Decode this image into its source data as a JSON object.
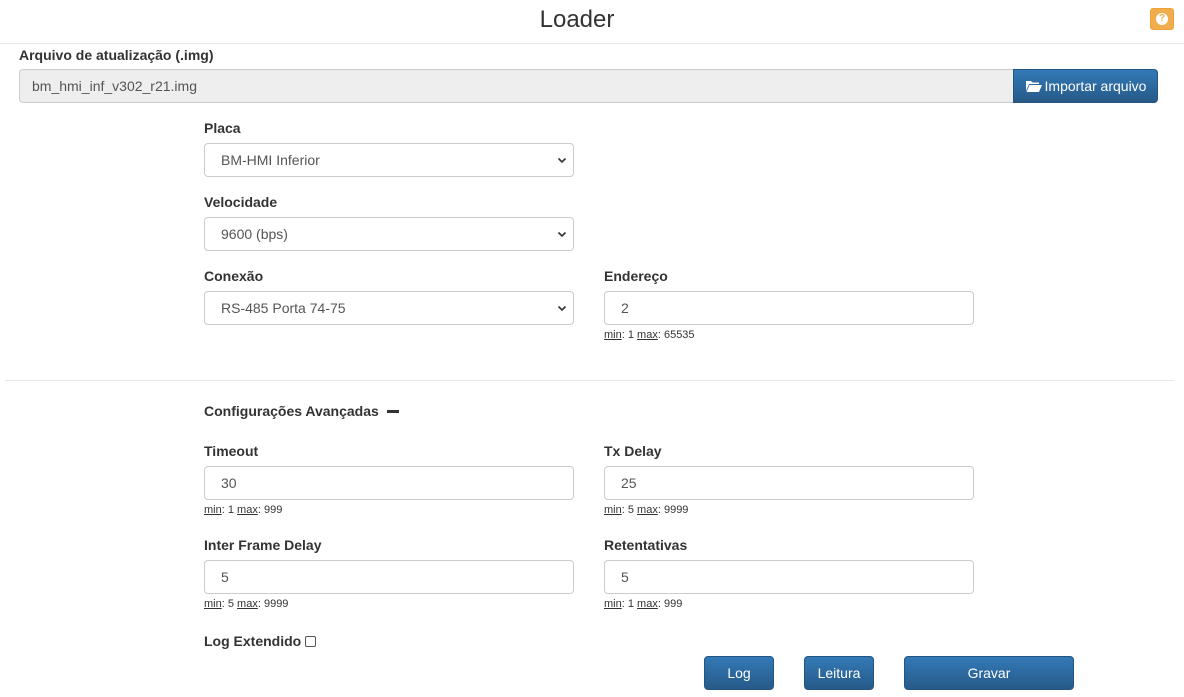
{
  "header": {
    "title": "Loader",
    "help_icon": "question-circle-icon"
  },
  "file": {
    "label": "Arquivo de atualização (.img)",
    "value": "bm_hmi_inf_v302_r21.img",
    "import_label": "Importar arquivo",
    "import_icon": "folder-open-icon"
  },
  "placa": {
    "label": "Placa",
    "value": "BM-HMI Inferior"
  },
  "velocidade": {
    "label": "Velocidade",
    "value": "9600 (bps)"
  },
  "conexao": {
    "label": "Conexão",
    "value": "RS-485 Porta 74-75"
  },
  "endereco": {
    "label": "Endereço",
    "value": "2",
    "min_label": "min",
    "min": "1",
    "max_label": "max",
    "max": "65535"
  },
  "advanced": {
    "label": "Configurações Avançadas",
    "timeout": {
      "label": "Timeout",
      "value": "30",
      "min_label": "min",
      "min": "1",
      "max_label": "max",
      "max": "999"
    },
    "tx_delay": {
      "label": "Tx Delay",
      "value": "25",
      "min_label": "min",
      "min": "5",
      "max_label": "max",
      "max": "9999"
    },
    "inter_frame_delay": {
      "label": "Inter Frame Delay",
      "value": "5",
      "min_label": "min",
      "min": "5",
      "max_label": "max",
      "max": "9999"
    },
    "retentativas": {
      "label": "Retentativas",
      "value": "5",
      "min_label": "min",
      "min": "1",
      "max_label": "max",
      "max": "999"
    },
    "log_extendido": {
      "label": "Log Extendido",
      "checked": false
    }
  },
  "actions": {
    "log": "Log",
    "leitura": "Leitura",
    "gravar": "Gravar"
  },
  "colors": {
    "primary": "#337ab7",
    "primary_dark": "#265a88",
    "warning": "#f0ad4e"
  }
}
